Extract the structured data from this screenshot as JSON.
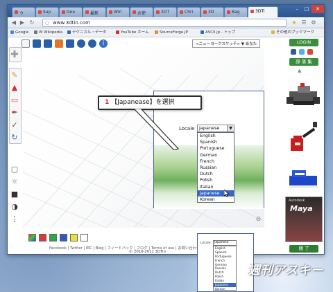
{
  "browser": {
    "tabs": [
      {
        "label": "ウ",
        "active": false
      },
      {
        "label": "Sup",
        "active": false
      },
      {
        "label": "Goo",
        "active": false
      },
      {
        "label": "最新",
        "active": false
      },
      {
        "label": "Wiri",
        "active": false
      },
      {
        "label": "お使",
        "active": false
      },
      {
        "label": "3DT",
        "active": false
      },
      {
        "label": "Chri",
        "active": false
      },
      {
        "label": "3D",
        "active": false
      },
      {
        "label": "Bag",
        "active": false
      },
      {
        "label": "3DTi",
        "active": true
      }
    ],
    "url": "www.3dtin.com",
    "bookmarks": [
      {
        "label": "Google",
        "color": "#4285f4"
      },
      {
        "label": "W Wikipedia",
        "color": "#777777"
      },
      {
        "label": "テクニカル・データ",
        "color": "#2b6cc4"
      },
      {
        "label": "YouTube ホーム",
        "color": "#d62d20"
      },
      {
        "label": "SourceForge.JP",
        "color": "#f08a24"
      },
      {
        "label": "ASCII.jp - トップ",
        "color": "#2b6cc4"
      },
      {
        "label": "その他のブックマーク",
        "color": "#e3b341"
      }
    ]
  },
  "app": {
    "title_badge": "<ニューヨークスケッチ> ▼ あなた",
    "callout": {
      "number": "1",
      "text": "【Japanease】を選択"
    },
    "locale_dialog": {
      "label": "Locale",
      "selected": "Japanese",
      "options": [
        "English",
        "Spanish",
        "Portuguese",
        "German",
        "French",
        "Russian",
        "Dutch",
        "Polish",
        "Italian",
        "Japanese",
        "Korean"
      ]
    },
    "footer_links": "Facebook | Twitter | IRC | Blog | フィードバック | ブログ | Terms of use | お問い合わせ",
    "copyright": "© 2010-2011 3DTin",
    "color_swatches": [
      "#d93a3a",
      "#2aa84a",
      "#2f58c7",
      "#e8e235",
      "#ffffff"
    ]
  },
  "right_panel": {
    "login_label": "LOGIN",
    "gallery_label": "部 落 集",
    "ad_top_text": "Autodesk",
    "ad_title": "Maya",
    "close_label": "閉 了"
  },
  "inset": {
    "label": "Locale",
    "selected": "Japanese",
    "options": [
      "English",
      "Spanish",
      "Portuguese",
      "French",
      "German",
      "Russian",
      "Dutch",
      "Polish",
      "Italian",
      "Japanese",
      "Korean"
    ]
  },
  "watermark": "週刊アスキー"
}
